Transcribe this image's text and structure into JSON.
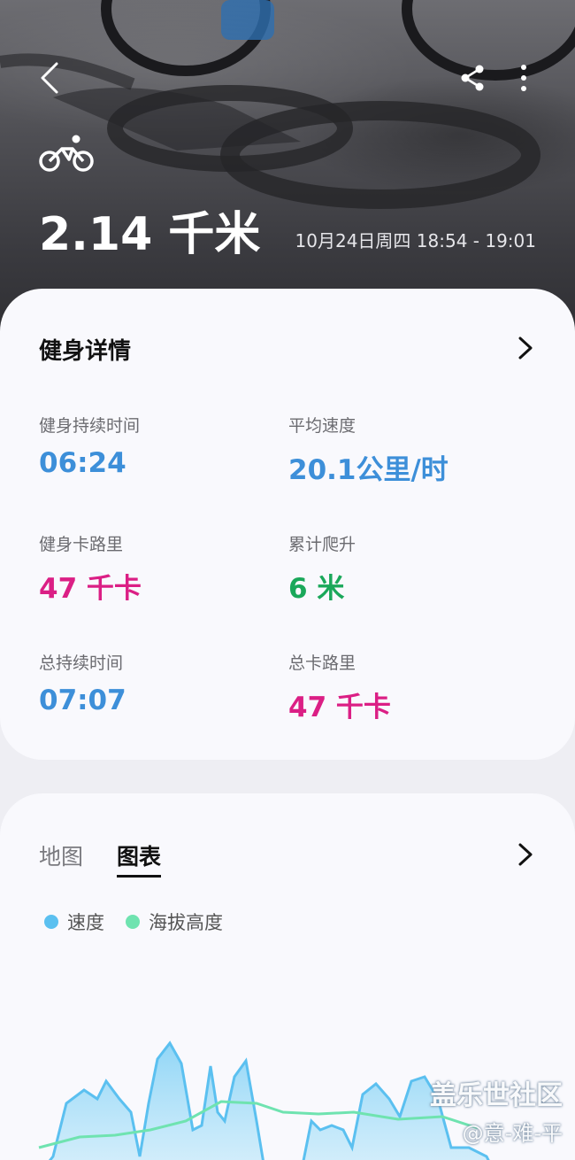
{
  "hero": {
    "distance": "2.14 千米",
    "date_range": "10月24日周四 18:54 - 19:01",
    "icons": {
      "back": "back-icon",
      "share": "share-icon",
      "more": "more-icon",
      "activity": "cycling-icon"
    }
  },
  "details": {
    "title": "健身详情",
    "stats": [
      {
        "label": "健身持续时间",
        "value": "06:24",
        "color": "#3d8fd9"
      },
      {
        "label": "平均速度",
        "value": "20.1公里/时",
        "color": "#3d8fd9"
      },
      {
        "label": "健身卡路里",
        "value": "47 千卡",
        "color": "#db1f85"
      },
      {
        "label": "累计爬升",
        "value": "6 米",
        "color": "#1aa85a"
      },
      {
        "label": "总持续时间",
        "value": "07:07",
        "color": "#3d8fd9"
      },
      {
        "label": "总卡路里",
        "value": "47 千卡",
        "color": "#db1f85"
      }
    ]
  },
  "charts_card": {
    "tabs": [
      {
        "label": "地图",
        "active": false
      },
      {
        "label": "图表",
        "active": true
      }
    ],
    "legend": [
      {
        "label": "速度",
        "color": "#5bc0f0"
      },
      {
        "label": "海拔高度",
        "color": "#6fe3b0"
      }
    ]
  },
  "watermark": {
    "brand": "盖乐世社区",
    "user": "@意-难-平"
  }
}
